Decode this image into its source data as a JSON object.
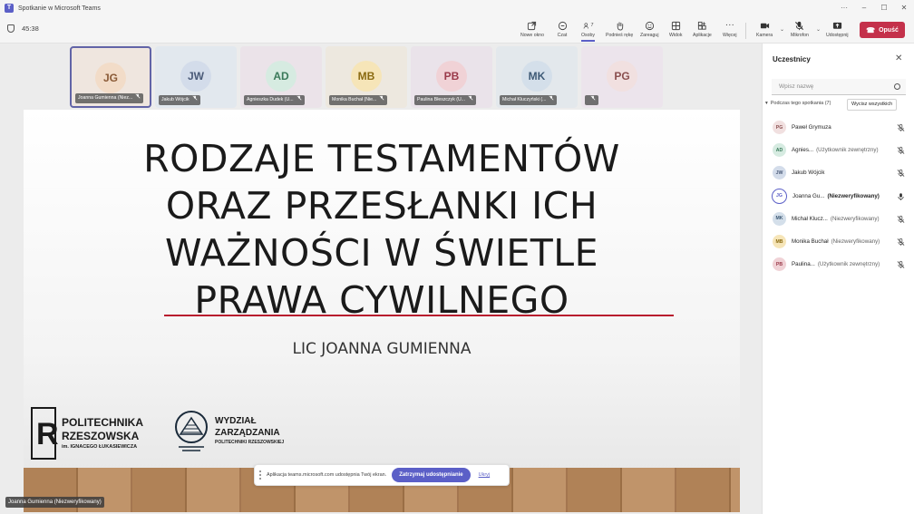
{
  "window": {
    "title": "Spotkanie w Microsoft Teams"
  },
  "toolbar": {
    "timer": "45:38",
    "buttons": [
      {
        "label": "Nowe okno",
        "icon": "new-window-icon"
      },
      {
        "label": "Czat",
        "icon": "chat-icon"
      },
      {
        "label": "Osoby",
        "icon": "people-icon",
        "count": "7"
      },
      {
        "label": "Podnieś rękę",
        "icon": "raise-hand-icon"
      },
      {
        "label": "Zareaguj",
        "icon": "react-icon"
      },
      {
        "label": "Widok",
        "icon": "view-icon"
      },
      {
        "label": "Aplikacje",
        "icon": "apps-icon"
      },
      {
        "label": "Więcej",
        "icon": "more-icon"
      },
      {
        "label": "Kamera",
        "icon": "camera-icon"
      },
      {
        "label": "Mikrofon",
        "icon": "mic-icon"
      },
      {
        "label": "Udostępnij",
        "icon": "share-icon"
      }
    ],
    "leave_label": "Opuść"
  },
  "tiles": [
    {
      "initials": "JG",
      "name": "Joanna Gumienna (Niez...",
      "bg": "#efe6df",
      "avbg": "#f2dcc8",
      "fg": "#8a5a36"
    },
    {
      "initials": "JW",
      "name": "Jakub Wójcik",
      "bg": "#e2e8ee",
      "avbg": "#d3dcea",
      "fg": "#4a5a78"
    },
    {
      "initials": "AD",
      "name": "Agnieszka Dudek (U...",
      "bg": "#ebe3e9",
      "avbg": "#d6ebe1",
      "fg": "#3a7a5a"
    },
    {
      "initials": "MB",
      "name": "Monika Buchał (Nie...",
      "bg": "#ede8df",
      "avbg": "#f6e5b8",
      "fg": "#8a6a10"
    },
    {
      "initials": "PB",
      "name": "Paulina Błeszczyk (U...",
      "bg": "#eae3ea",
      "avbg": "#f0d2d6",
      "fg": "#9a3a4a"
    },
    {
      "initials": "MK",
      "name": "Michał Kluczyński (...",
      "bg": "#e3e8ec",
      "avbg": "#d4dfea",
      "fg": "#3e5a76"
    },
    {
      "initials": "PG",
      "name": "",
      "bg": "#ece4ec",
      "avbg": "#f1e0e0",
      "fg": "#8a5050"
    }
  ],
  "slide": {
    "title": "RODZAJE TESTAMENTÓW ORAZ PRZESŁANKI ICH WAŻNOŚCI W ŚWIETLE PRAWA CYWILNEGO",
    "author": "LIC JOANNA GUMIENNA",
    "logo1": {
      "line1": "POLITECHNIKA",
      "line2": "RZESZOWSKA",
      "line3": "im. IGNACEGO ŁUKASIEWICZA"
    },
    "logo2": {
      "line1": "WYDZIAŁ",
      "line2": "ZARZĄDZANIA",
      "line3": "POLITECHNIKI RZESZOWSKIEJ"
    }
  },
  "speaker_label": "Joanna Gumienna (Niezweryfikowany)",
  "share_banner": {
    "text": "Aplikacja teams.microsoft.com udostępnia Twój ekran.",
    "stop_label": "Zatrzymaj udostępnianie",
    "hide_label": "Ukryj"
  },
  "panel": {
    "title": "Uczestnicy",
    "search_placeholder": "Wpisz nazwę",
    "section_label": "Podczas tego spotkania (7)",
    "mute_all_label": "Wycisz wszystkich",
    "participants": [
      {
        "initials": "PG",
        "name": "Paweł Grymuza",
        "role": "",
        "avbg": "#f1e0e0",
        "fg": "#8a5050",
        "muted": true
      },
      {
        "initials": "AD",
        "name": "Agnies...",
        "role": "(Użytkownik zewnętrzny)",
        "avbg": "#d6ebe1",
        "fg": "#3a7a5a",
        "muted": true
      },
      {
        "initials": "JW",
        "name": "Jakub Wójcik",
        "role": "",
        "avbg": "#d3dcea",
        "fg": "#4a5a78",
        "muted": true
      },
      {
        "initials": "JG",
        "name": "Joanna Gu...",
        "role": "(Niezweryfikowany)",
        "avbg": "#ffffff",
        "fg": "#5b5fc7",
        "muted": false,
        "bold": true
      },
      {
        "initials": "MK",
        "name": "Michał Klucz...",
        "role": "(Niezweryfikowany)",
        "avbg": "#d4dfea",
        "fg": "#3e5a76",
        "muted": true
      },
      {
        "initials": "MB",
        "name": "Monika Buchał",
        "role": "(Niezweryfikowany)",
        "avbg": "#f6e5b8",
        "fg": "#8a6a10",
        "muted": true
      },
      {
        "initials": "PB",
        "name": "Paulina...",
        "role": "(Użytkownik zewnętrzny)",
        "avbg": "#f0d2d6",
        "fg": "#9a3a4a",
        "muted": true
      }
    ]
  }
}
